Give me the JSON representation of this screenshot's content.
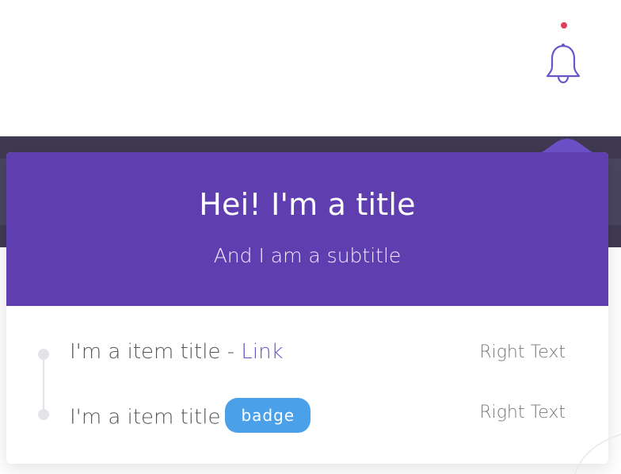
{
  "popup": {
    "title": "Hei! I'm a title",
    "subtitle": "And I am a subtitle"
  },
  "items": [
    {
      "title": "I'm a item title -",
      "link": "Link",
      "right": "Right Text"
    },
    {
      "title": "I'm a item title",
      "badge": "badge",
      "right": "Right Text"
    }
  ],
  "colors": {
    "header": "#5f3fb0",
    "link": "#6a4fc5",
    "badge": "#4aa1ea",
    "notification_dot": "#e0405a",
    "dark_band": "#3f3a52"
  },
  "icons": {
    "bell": "bell-icon",
    "notification": "notification-dot"
  }
}
